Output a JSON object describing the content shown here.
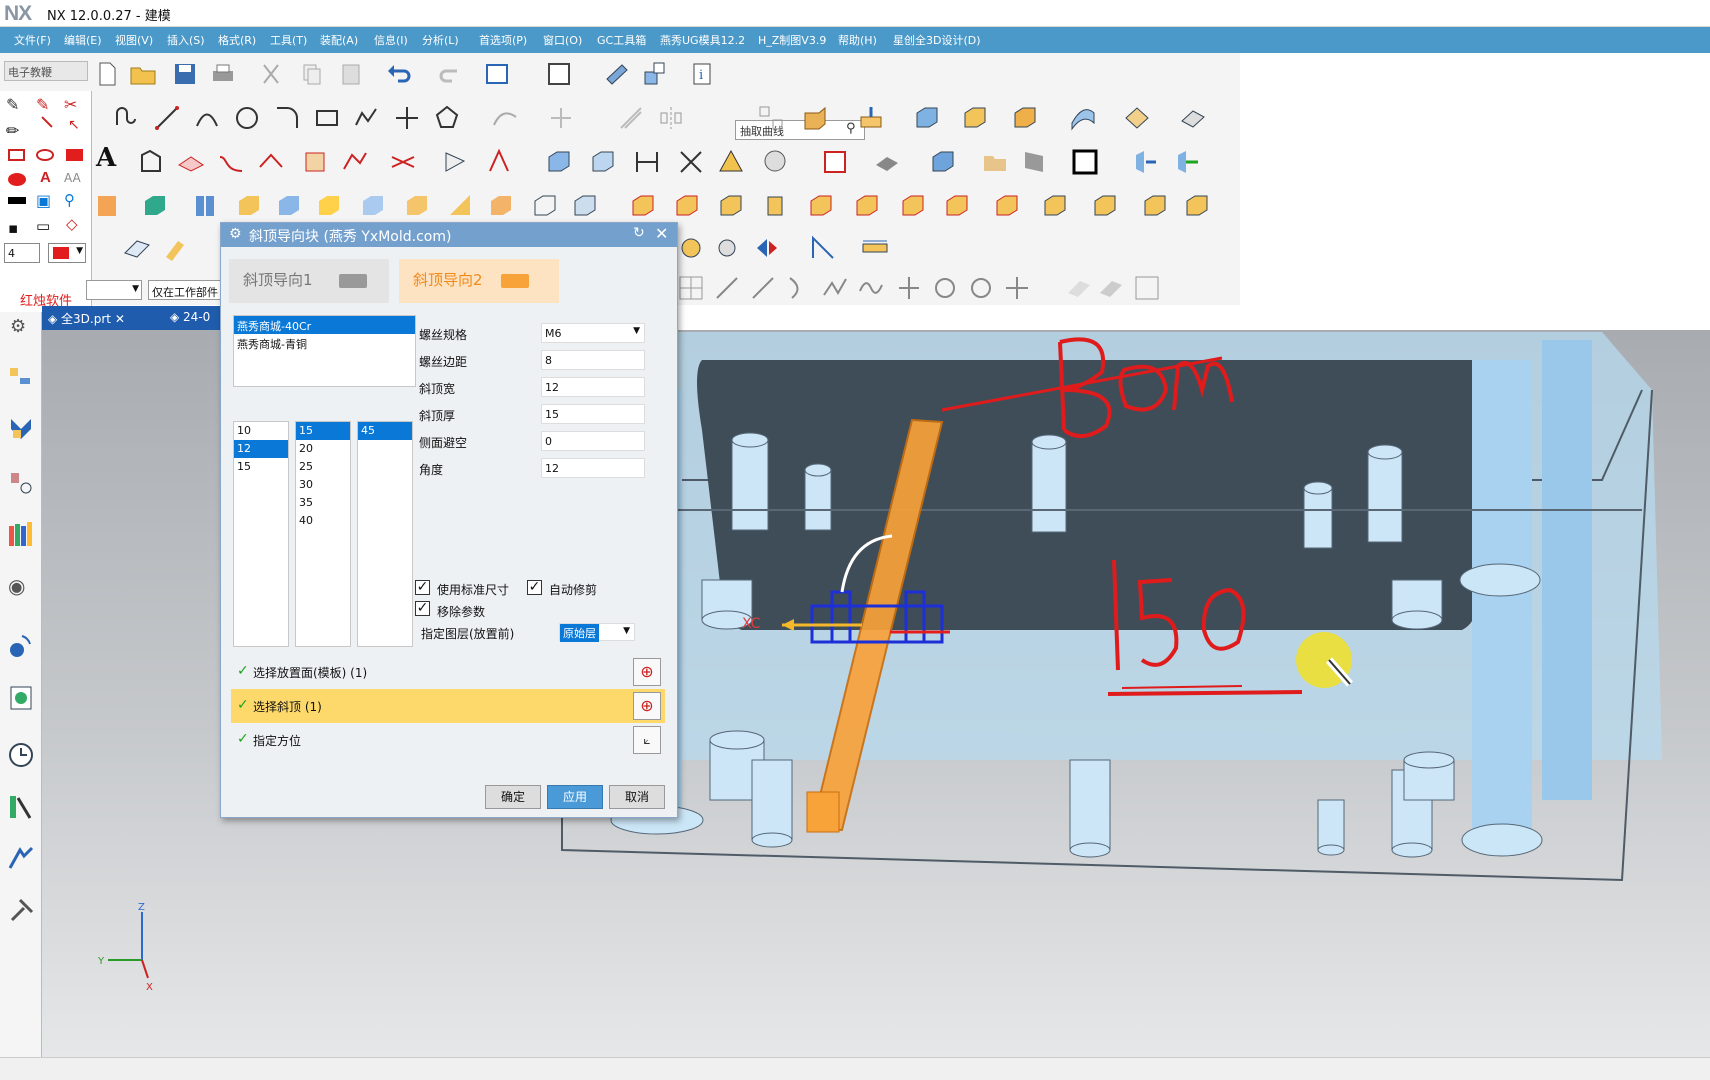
{
  "window": {
    "logo": "NX",
    "title": "NX 12.0.0.27 - 建模"
  },
  "menu": [
    "文件(F)",
    "编辑(E)",
    "视图(V)",
    "插入(S)",
    "格式(R)",
    "工具(T)",
    "装配(A)",
    "信息(I)",
    "分析(L)",
    "首选项(P)",
    "窗口(O)",
    "GC工具箱",
    "燕秀UG模具12.2",
    "H_Z制图V3.9",
    "帮助(H)",
    "星创全3D设计(D)"
  ],
  "toolbar": {
    "search_placeholder": "抽取曲线",
    "left_field": "电子教鞭",
    "filter": "仅在工作部件",
    "layer_num": "4"
  },
  "side_panel_label": "红烛软件",
  "tabs": [
    {
      "label": "全3D.prt"
    },
    {
      "label": "24-0"
    }
  ],
  "dialog": {
    "title": "斜顶导向块  (燕秀 YxMold.com)",
    "tab1": "斜顶导向1",
    "tab2": "斜顶导向2",
    "materials": [
      "燕秀商城-40Cr",
      "燕秀商城-青铜"
    ],
    "col1": [
      "10",
      "12",
      "15"
    ],
    "col2": [
      "15",
      "20",
      "25",
      "30",
      "35",
      "40"
    ],
    "col3": [
      "45"
    ],
    "params": [
      {
        "label": "螺丝规格",
        "value": "M6"
      },
      {
        "label": "螺丝边距",
        "value": "8"
      },
      {
        "label": "斜顶宽",
        "value": "12"
      },
      {
        "label": "斜顶厚",
        "value": "15"
      },
      {
        "label": "侧面避空",
        "value": "0"
      },
      {
        "label": "角度",
        "value": "12"
      }
    ],
    "chk_standard": "使用标准尺寸",
    "chk_auto": "自动修剪",
    "chk_remove": "移除参数",
    "layer_label": "指定图层(放置前)",
    "layer_value": "原始层",
    "steps": [
      "选择放置面(模板) (1)",
      "选择斜顶 (1)",
      "指定方位"
    ],
    "ok": "确定",
    "apply": "应用",
    "cancel": "取消"
  },
  "annotations": {
    "top": "Bom",
    "mid": "150"
  },
  "axis": {
    "xc": "XC",
    "z": "Z",
    "y": "Y",
    "x": "X"
  },
  "colors": {
    "menubar": "#4b99c9",
    "dialog_title": "#74a0cd",
    "highlight": "#fdd86a",
    "accent_red": "#e21d1d",
    "selection_blue": "#0a78d7",
    "slider_orange": "#f8a23a"
  }
}
